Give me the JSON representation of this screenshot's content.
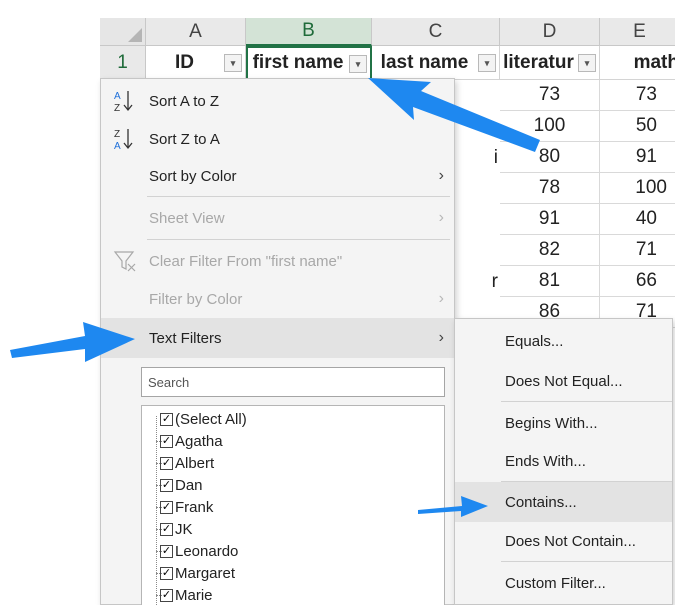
{
  "columns": [
    {
      "letter": "A",
      "active": false
    },
    {
      "letter": "B",
      "active": true
    },
    {
      "letter": "C",
      "active": false
    },
    {
      "letter": "D",
      "active": false
    },
    {
      "letter": "E",
      "active": false
    }
  ],
  "row_number": "1",
  "headers": [
    "ID",
    "first name",
    "last name",
    "literatur",
    "math"
  ],
  "literature_values": [
    "73",
    "100",
    "80",
    "78",
    "91",
    "82",
    "81",
    "86"
  ],
  "math_values": [
    "73",
    "50",
    "91",
    "100",
    "40",
    "71",
    "66",
    "71"
  ],
  "lastname_fragments": {
    "row4": "i",
    "row8": "r"
  },
  "menu": {
    "sort_az": "Sort A to Z",
    "sort_za": "Sort Z to A",
    "sort_by_color": "Sort by Color",
    "sheet_view": "Sheet View",
    "clear_filter": "Clear Filter From \"first name\"",
    "filter_by_color": "Filter by Color",
    "text_filters": "Text Filters",
    "search_placeholder": "Search",
    "chevron": "›"
  },
  "filter_values": [
    {
      "label": "(Select All)",
      "checked": true
    },
    {
      "label": "Agatha",
      "checked": true
    },
    {
      "label": "Albert",
      "checked": true
    },
    {
      "label": "Dan",
      "checked": true
    },
    {
      "label": "Frank",
      "checked": true
    },
    {
      "label": "JK",
      "checked": true
    },
    {
      "label": "Leonardo",
      "checked": true
    },
    {
      "label": "Margaret",
      "checked": true
    },
    {
      "label": "Marie",
      "checked": true
    }
  ],
  "checkmark": "✓",
  "filter_glyph": "▾",
  "submenu": {
    "equals": "Equals...",
    "not_equal": "Does Not Equal...",
    "begins_with": "Begins With...",
    "ends_with": "Ends With...",
    "contains": "Contains...",
    "not_contain": "Does Not Contain...",
    "custom_filter": "Custom Filter..."
  },
  "colors": {
    "accent_green": "#217346",
    "arrow_blue": "#1e88f0",
    "menu_bg": "#f4f4f4",
    "highlight": "#e3e3e3"
  },
  "icons": {
    "sort_az": "sort-ascending-icon",
    "sort_za": "sort-descending-icon",
    "clear_filter": "clear-filter-icon",
    "chevron": "chevron-right-icon",
    "filter_button": "filter-dropdown-icon"
  }
}
